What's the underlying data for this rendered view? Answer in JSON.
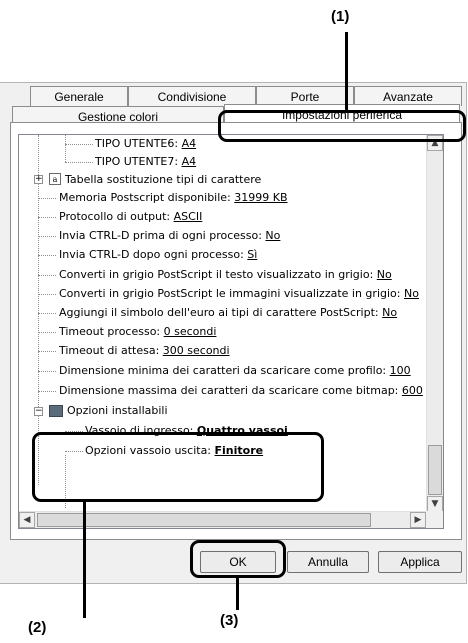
{
  "callouts": {
    "c1": "(1)",
    "c2": "(2)",
    "c3": "(3)"
  },
  "tabs": {
    "row1": [
      "Generale",
      "Condivisione",
      "Porte",
      "Avanzate"
    ],
    "row2": [
      "Gestione colori",
      "Impostazioni periferica"
    ],
    "active": "Impostazioni periferica"
  },
  "tree": {
    "user_type6": {
      "label": "TIPO UTENTE6: ",
      "value": "A4"
    },
    "user_type7": {
      "label": "TIPO UTENTE7: ",
      "value": "A4"
    },
    "font_table": {
      "label": "Tabella sostituzione tipi di carattere"
    },
    "ps_memory": {
      "label": "Memoria Postscript disponibile: ",
      "value": "31999 KB"
    },
    "output_protocol": {
      "label": "Protocollo di output: ",
      "value": "ASCII"
    },
    "ctrl_d_before": {
      "label": "Invia CTRL-D prima di ogni processo: ",
      "value": "No"
    },
    "ctrl_d_after": {
      "label": "Invia CTRL-D dopo ogni processo: ",
      "value": "Sì"
    },
    "gray_text": {
      "label": "Converti in grigio PostScript il testo visualizzato in grigio: ",
      "value": "No"
    },
    "gray_images": {
      "label": "Converti in grigio PostScript le immagini visualizzate in grigio: ",
      "value": "No"
    },
    "euro_symbol": {
      "label": "Aggiungi il simbolo dell'euro ai tipi di carattere PostScript: ",
      "value": "No"
    },
    "job_timeout": {
      "label": "Timeout processo: ",
      "value": "0 secondi"
    },
    "wait_timeout": {
      "label": "Timeout di attesa: ",
      "value": "300 secondi"
    },
    "min_font": {
      "label": "Dimensione minima dei caratteri da scaricare come profilo: ",
      "value": "100"
    },
    "max_font": {
      "label": "Dimensione massima dei caratteri da scaricare come bitmap: ",
      "value": "600"
    },
    "installable": {
      "label": "Opzioni installabili"
    },
    "input_tray": {
      "label": "Vassoio di ingresso: ",
      "value": "Quattro vassoi"
    },
    "output_tray": {
      "label": "Opzioni vassoio uscita: ",
      "value": "Finitore"
    }
  },
  "buttons": {
    "ok": "OK",
    "cancel": "Annulla",
    "apply": "Applica"
  }
}
